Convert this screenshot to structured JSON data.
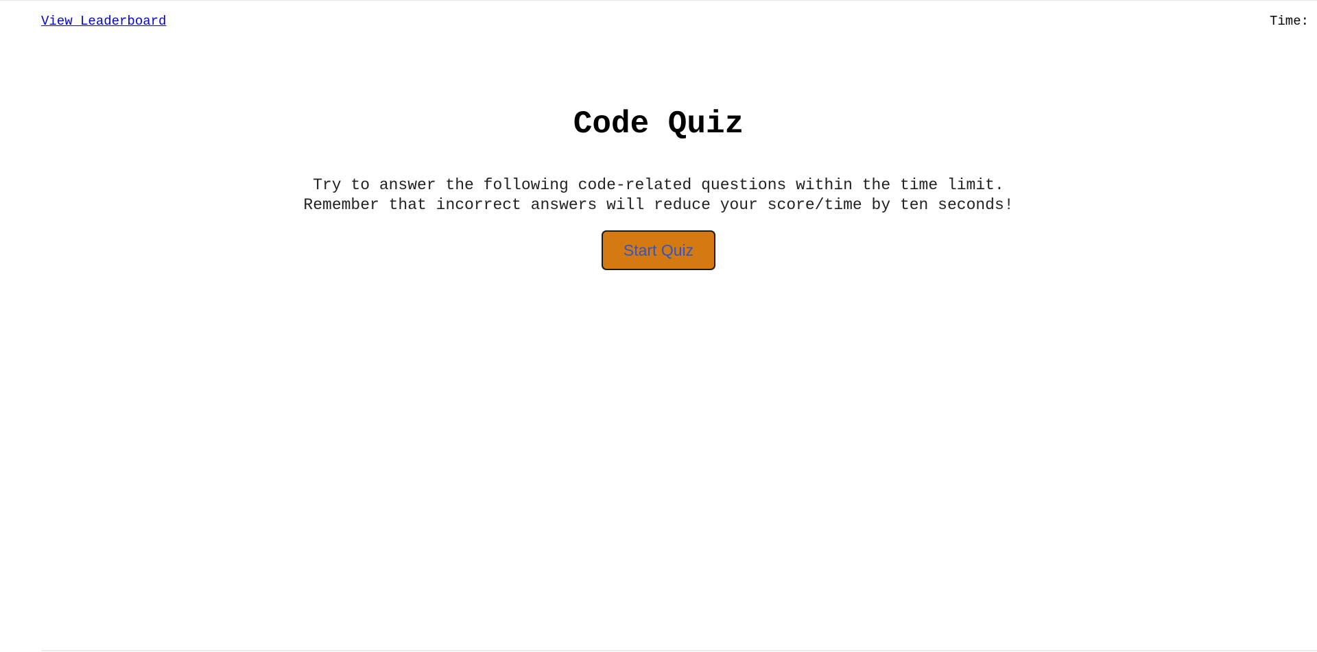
{
  "header": {
    "leaderboard_link": "View Leaderboard",
    "timer_label": "Time:"
  },
  "main": {
    "title": "Code Quiz",
    "intro_line1": "Try to answer the following code-related questions within the time limit.",
    "intro_line2": "Remember that incorrect answers will reduce your score/time by ten seconds!",
    "start_button": "Start Quiz"
  },
  "colors": {
    "link": "#0000ee",
    "button_background": "#d57a10",
    "button_text": "#2f55c8",
    "background": "#ffffff"
  }
}
